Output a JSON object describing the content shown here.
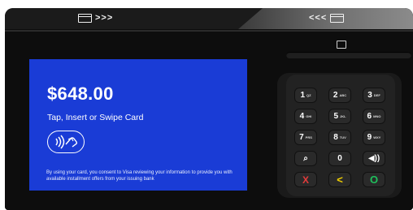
{
  "screen": {
    "amount": "$648.00",
    "prompt": "Tap, Insert or Swipe Card",
    "consent_text": "By using your card, you consent to Visa reviewing your information to provide you with available installment offers from your issuing bank",
    "background_color": "#1a3cd6"
  },
  "top_bar": {
    "left_arrows": ">>>",
    "right_arrows": "<<<"
  },
  "keypad": {
    "rows": [
      [
        {
          "main": "1",
          "sub": "QZ"
        },
        {
          "main": "2",
          "sub": "ABC"
        },
        {
          "main": "3",
          "sub": "DEF"
        }
      ],
      [
        {
          "main": "4",
          "sub": "GHI"
        },
        {
          "main": "5",
          "sub": "JKL"
        },
        {
          "main": "6",
          "sub": "MNO"
        }
      ],
      [
        {
          "main": "7",
          "sub": "PRS"
        },
        {
          "main": "8",
          "sub": "TUV"
        },
        {
          "main": "9",
          "sub": "WXY"
        }
      ],
      [
        {
          "main": "⌕",
          "sub": ""
        },
        {
          "main": "0",
          "sub": ""
        },
        {
          "main": "◀))",
          "sub": ""
        }
      ],
      [
        {
          "main": "X",
          "sub": ""
        },
        {
          "main": "<",
          "sub": ""
        },
        {
          "main": "O",
          "sub": ""
        }
      ]
    ],
    "colors": {
      "cancel": "#e43b3b",
      "clear": "#f3d100",
      "enter": "#1fc05c"
    }
  },
  "icons": {
    "card_slot_left": "card-icon",
    "card_slot_right": "card-icon",
    "chip_insert": "chip-icon",
    "contactless": "contactless-icon"
  }
}
